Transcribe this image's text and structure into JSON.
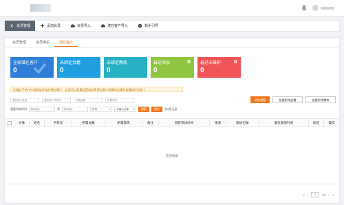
{
  "header": {
    "notification_icon": "bell-icon"
  },
  "toolbar": {
    "back_label": "会员管理",
    "add_member": "添加会员",
    "import_members": "会员导入",
    "import_prospects": "潜在客户导入",
    "guide": "新手引导"
  },
  "tabs": [
    "会员管理",
    "会员维护",
    "潜在客户"
  ],
  "active_tab": 2,
  "cards": [
    {
      "label": "全部潜在客户",
      "value": "0",
      "color": "#2f7fd9"
    },
    {
      "label": "未绑定会籍",
      "value": "0",
      "color": "#1f9fe0"
    },
    {
      "label": "未绑定教练",
      "value": "0",
      "color": "#26b2c4"
    },
    {
      "label": "最近添加",
      "value": "0",
      "color": "#8fc540"
    },
    {
      "label": "最近未维护",
      "value": "0",
      "color": "#f05454"
    }
  ],
  "notice": "在帽在手机APP端添加并维护潜在客户，这里可以批量设置或变更潜在客户所属的会籍并查看维护记录 ×",
  "actions": {
    "add_prospect": "添加潜客",
    "batch_change_membership": "批量更改会籍",
    "batch_change_coach": "批量更改教练"
  },
  "filters": {
    "name_placeholder": "潜在客户姓名",
    "phone_placeholder": "潜在客户手机号",
    "membership_placeholder": "所属会籍",
    "coach_placeholder": "所属教练"
  },
  "date_filter": {
    "label": "潜客添加时间",
    "start": "年/月/日",
    "to": "到",
    "end": "年/月/日",
    "status_select": "所有",
    "visit_select": "未确认来源",
    "search_btn": "搜索",
    "export_btn": "导出",
    "count_text": "共0条记录"
  },
  "table": {
    "columns": [
      "头像",
      "姓名",
      "手机号",
      "所属会籍",
      "所属教练",
      "备注",
      "潜客添加时间",
      "来源",
      "跟进记录",
      "最近跟进时间",
      "标签",
      "操作"
    ],
    "empty_text": "暂无数据"
  },
  "pager": {
    "current": "1",
    "suffix": "/ 0",
    "go": ">"
  }
}
